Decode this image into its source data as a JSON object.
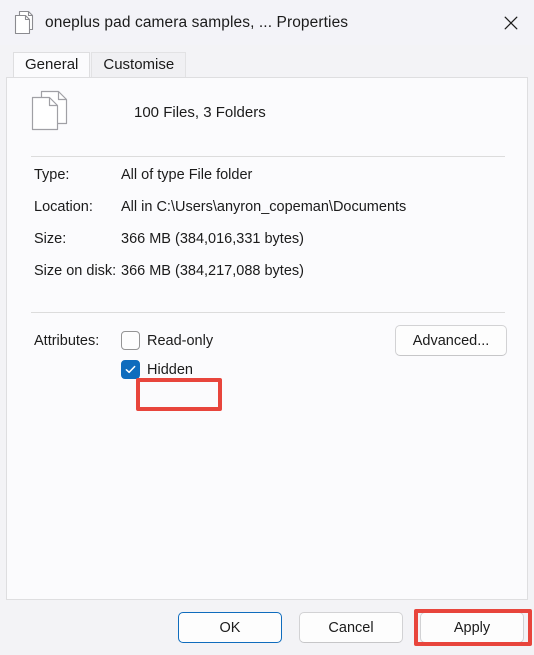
{
  "window": {
    "title": "oneplus pad camera samples, ... Properties",
    "icon": "documents-stack-icon",
    "close_label": "Close"
  },
  "tabs": [
    {
      "label": "General",
      "active": true
    },
    {
      "label": "Customise",
      "active": false
    }
  ],
  "general": {
    "item_count_text": "100 Files, 3 Folders",
    "header_icon": "documents-stack-icon",
    "properties": [
      {
        "label": "Type:",
        "value": "All of type File folder"
      },
      {
        "label": "Location:",
        "value": "All in C:\\Users\\anyron_copeman\\Documents"
      },
      {
        "label": "Size:",
        "value": "366 MB (384,016,331 bytes)"
      },
      {
        "label": "Size on disk:",
        "value": "366 MB (384,217,088 bytes)"
      }
    ],
    "attributes": {
      "label": "Attributes:",
      "read_only": {
        "label": "Read-only",
        "checked": false
      },
      "hidden": {
        "label": "Hidden",
        "checked": true
      },
      "advanced_label": "Advanced..."
    }
  },
  "footer": {
    "ok_label": "OK",
    "cancel_label": "Cancel",
    "apply_label": "Apply"
  },
  "annotations": {
    "color": "#e8453c",
    "targets": [
      "hidden-checkbox",
      "apply-button"
    ]
  },
  "colors": {
    "accent": "#0f6cbd",
    "annotation_red": "#e8453c",
    "panel_background": "#fbfbfd",
    "window_background": "#f3f3f6"
  }
}
